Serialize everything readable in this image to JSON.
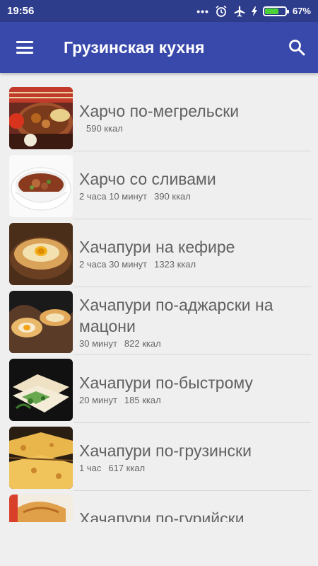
{
  "status": {
    "time": "19:56",
    "battery": "67%",
    "battery_level": 0.67
  },
  "appbar": {
    "title": "Грузинская кухня"
  },
  "recipes": [
    {
      "name": "Харчо по-мегрельски",
      "time": "",
      "kcal": "590 ккал"
    },
    {
      "name": "Харчо со сливами",
      "time": "2 часа 10 минут",
      "kcal": "390 ккал"
    },
    {
      "name": "Хачапури на кефире",
      "time": "2 часа 30 минут",
      "kcal": "1323 ккал"
    },
    {
      "name": "Хачапури по-аджарски на мацони",
      "time": "30 минут",
      "kcal": "822 ккал"
    },
    {
      "name": "Хачапури по-быстрому",
      "time": "20 минут",
      "kcal": "185 ккал"
    },
    {
      "name": "Хачапури по-грузински",
      "time": "1 час",
      "kcal": "617 ккал"
    },
    {
      "name": "Хачапури по-гурийски",
      "time": "",
      "kcal": ""
    }
  ]
}
